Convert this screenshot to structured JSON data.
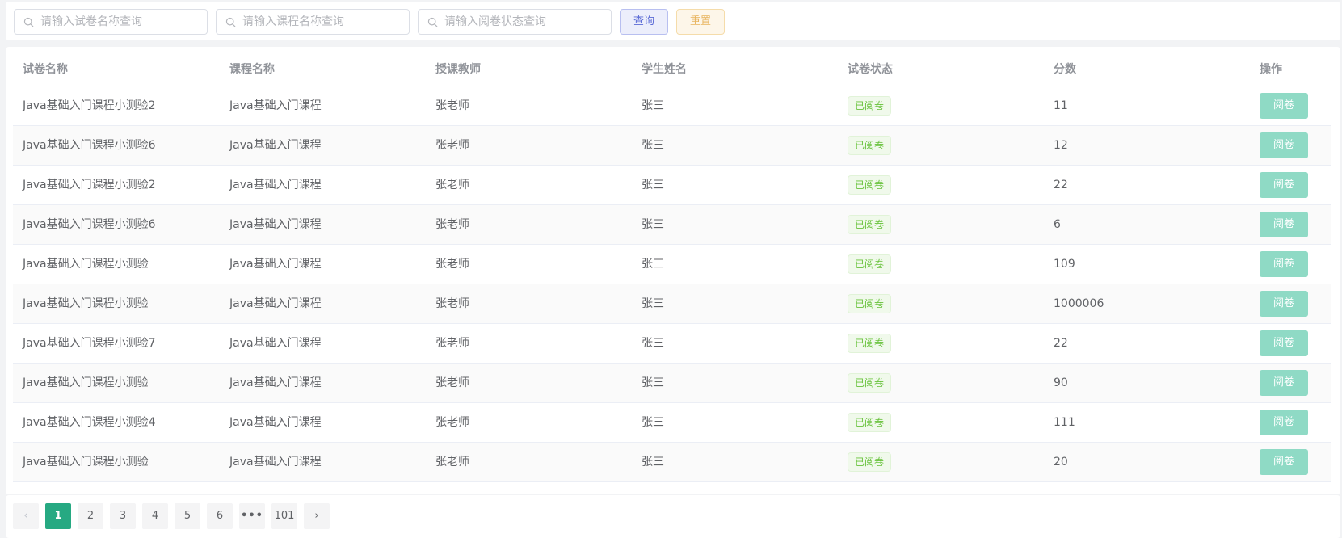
{
  "search": {
    "paper_placeholder": "请输入试卷名称查询",
    "course_placeholder": "请输入课程名称查询",
    "status_placeholder": "请输入阅卷状态查询",
    "query_label": "查询",
    "reset_label": "重置"
  },
  "table": {
    "headers": [
      "试卷名称",
      "课程名称",
      "授课教师",
      "学生姓名",
      "试卷状态",
      "分数",
      "操作"
    ],
    "action_label": "阅卷",
    "rows": [
      {
        "paper": "Java基础入门课程小测验2",
        "course": "Java基础入门课程",
        "teacher": "张老师",
        "student": "张三",
        "status": "已阅卷",
        "score": "11"
      },
      {
        "paper": "Java基础入门课程小测验6",
        "course": "Java基础入门课程",
        "teacher": "张老师",
        "student": "张三",
        "status": "已阅卷",
        "score": "12"
      },
      {
        "paper": "Java基础入门课程小测验2",
        "course": "Java基础入门课程",
        "teacher": "张老师",
        "student": "张三",
        "status": "已阅卷",
        "score": "22"
      },
      {
        "paper": "Java基础入门课程小测验6",
        "course": "Java基础入门课程",
        "teacher": "张老师",
        "student": "张三",
        "status": "已阅卷",
        "score": "6"
      },
      {
        "paper": "Java基础入门课程小测验",
        "course": "Java基础入门课程",
        "teacher": "张老师",
        "student": "张三",
        "status": "已阅卷",
        "score": "109"
      },
      {
        "paper": "Java基础入门课程小测验",
        "course": "Java基础入门课程",
        "teacher": "张老师",
        "student": "张三",
        "status": "已阅卷",
        "score": "1000006"
      },
      {
        "paper": "Java基础入门课程小测验7",
        "course": "Java基础入门课程",
        "teacher": "张老师",
        "student": "张三",
        "status": "已阅卷",
        "score": "22"
      },
      {
        "paper": "Java基础入门课程小测验",
        "course": "Java基础入门课程",
        "teacher": "张老师",
        "student": "张三",
        "status": "已阅卷",
        "score": "90"
      },
      {
        "paper": "Java基础入门课程小测验4",
        "course": "Java基础入门课程",
        "teacher": "张老师",
        "student": "张三",
        "status": "已阅卷",
        "score": "111"
      },
      {
        "paper": "Java基础入门课程小测验",
        "course": "Java基础入门课程",
        "teacher": "张老师",
        "student": "张三",
        "status": "已阅卷",
        "score": "20"
      }
    ]
  },
  "pagination": {
    "prev_icon": "chevron-left-icon",
    "next_icon": "chevron-right-icon",
    "prev_glyph": "‹",
    "next_glyph": "›",
    "pages": [
      "1",
      "2",
      "3",
      "4",
      "5",
      "6"
    ],
    "more_glyph": "•••",
    "last_page": "101",
    "current": "1"
  },
  "colors": {
    "accent": "#26a982",
    "review_button": "#8fdac5",
    "status_green": "#67c23a",
    "query_text": "#5b6bd6",
    "reset_text": "#e8b45e"
  }
}
